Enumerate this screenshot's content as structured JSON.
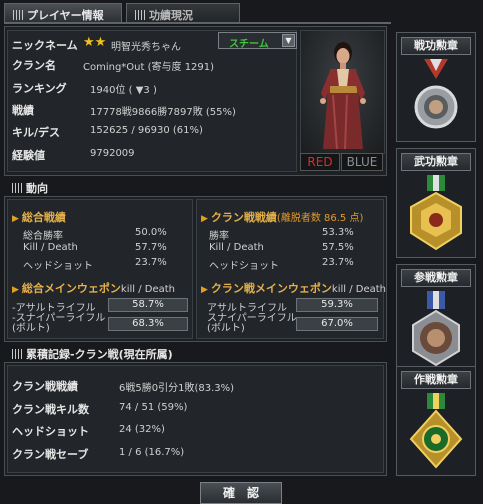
{
  "tabs": [
    {
      "label": "プレイヤー情報"
    },
    {
      "label": "功績現況"
    }
  ],
  "profile": {
    "rows": [
      {
        "label": "ニックネーム",
        "value": "明智光秀ちゃん"
      },
      {
        "label": "クラン名",
        "value": "Coming*Out (寄与度 1291)"
      },
      {
        "label": "ランキング",
        "value": "1940位 ( ▼3 )"
      },
      {
        "label": "戦績",
        "value": "17778戦9866勝7897敗 (55%)"
      },
      {
        "label": "キル/デス",
        "value": "152625 / 96930 (61%)"
      },
      {
        "label": "経験値",
        "value": "9792009"
      }
    ],
    "rank_stars": "★★",
    "server_select": "スチーム",
    "team_red": "RED",
    "team_blue": "BLUE"
  },
  "trend": {
    "title": "動向",
    "overall": {
      "title": "総合戦績",
      "rows": [
        {
          "label": "総合勝率",
          "value": "50.0%"
        },
        {
          "label": "Kill / Death",
          "value": "57.7%"
        },
        {
          "label": "ヘッドショット",
          "value": "23.7%"
        }
      ]
    },
    "clan": {
      "title": "クラン戦戦績",
      "note": "(離脱者数 86.5 点)",
      "rows": [
        {
          "label": "勝率",
          "value": "53.3%"
        },
        {
          "label": "Kill / Death",
          "value": "57.5%"
        },
        {
          "label": "ヘッドショット",
          "value": "23.7%"
        }
      ]
    },
    "overall_weapon": {
      "title": "総合メインウェポン",
      "sub": "kill / Death",
      "rows": [
        {
          "label": "-アサルトライフル",
          "value": "58.7%",
          "level": 0.587
        },
        {
          "label": "-スナイパーライフル\n(ボルト)",
          "value": "68.3%",
          "level": 0.683
        }
      ]
    },
    "clan_weapon": {
      "title": "クラン戦メインウェポン",
      "sub": "kill / Death",
      "rows": [
        {
          "label": "アサルトライフル",
          "value": "59.3%",
          "level": 0.593
        },
        {
          "label": "スナイパーライフル\n(ボルト)",
          "value": "67.0%",
          "level": 0.67
        }
      ]
    }
  },
  "record": {
    "title": "累積記録-クラン戦(現在所属)",
    "rows": [
      {
        "label": "クラン戦戦績",
        "value": "6戦5勝0引分1敗(83.3%)"
      },
      {
        "label": "クラン戦キル数",
        "value": "74 / 51 (59%)"
      },
      {
        "label": "ヘッドショット",
        "value": "24 (32%)"
      },
      {
        "label": "クラン戦セーブ",
        "value": "1 / 6 (16.7%)"
      }
    ]
  },
  "medals": [
    {
      "title": "戦功勲章"
    },
    {
      "title": "武功勲章"
    },
    {
      "title": "参戦勲章"
    },
    {
      "title": "作戦勲章"
    }
  ],
  "confirm_button": "確　認"
}
